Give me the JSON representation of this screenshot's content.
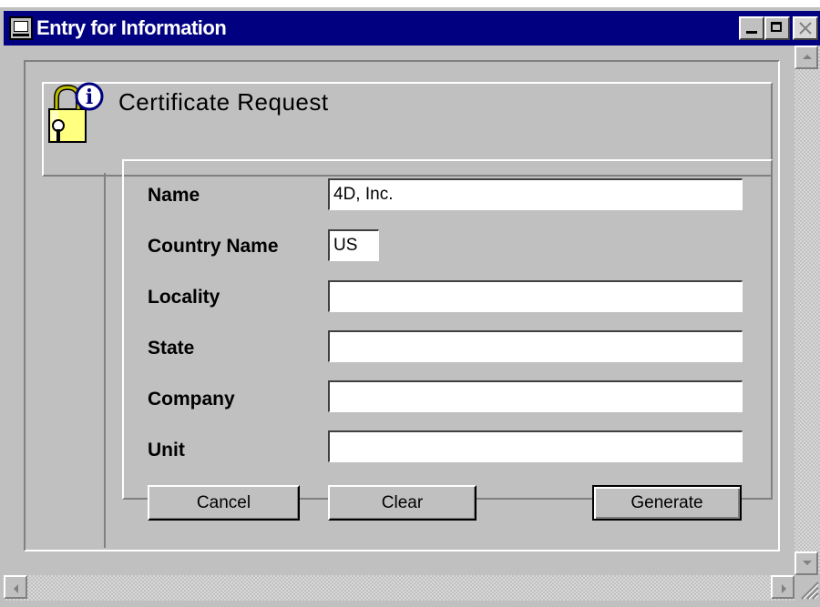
{
  "window": {
    "title": "Entry for Information"
  },
  "header": {
    "title": "Certificate Request"
  },
  "form": {
    "fields": [
      {
        "label": "Name",
        "value": "4D, Inc."
      },
      {
        "label": "Country Name",
        "value": "US"
      },
      {
        "label": "Locality",
        "value": ""
      },
      {
        "label": "State",
        "value": ""
      },
      {
        "label": "Company",
        "value": ""
      },
      {
        "label": "Unit",
        "value": ""
      }
    ]
  },
  "buttons": {
    "cancel": "Cancel",
    "clear": "Clear",
    "generate": "Generate"
  },
  "icons": {
    "window": "app-window-icon",
    "certificate": "lock-info-icon"
  },
  "colors": {
    "titlebar": "#000080",
    "face": "#c0c0c0"
  }
}
